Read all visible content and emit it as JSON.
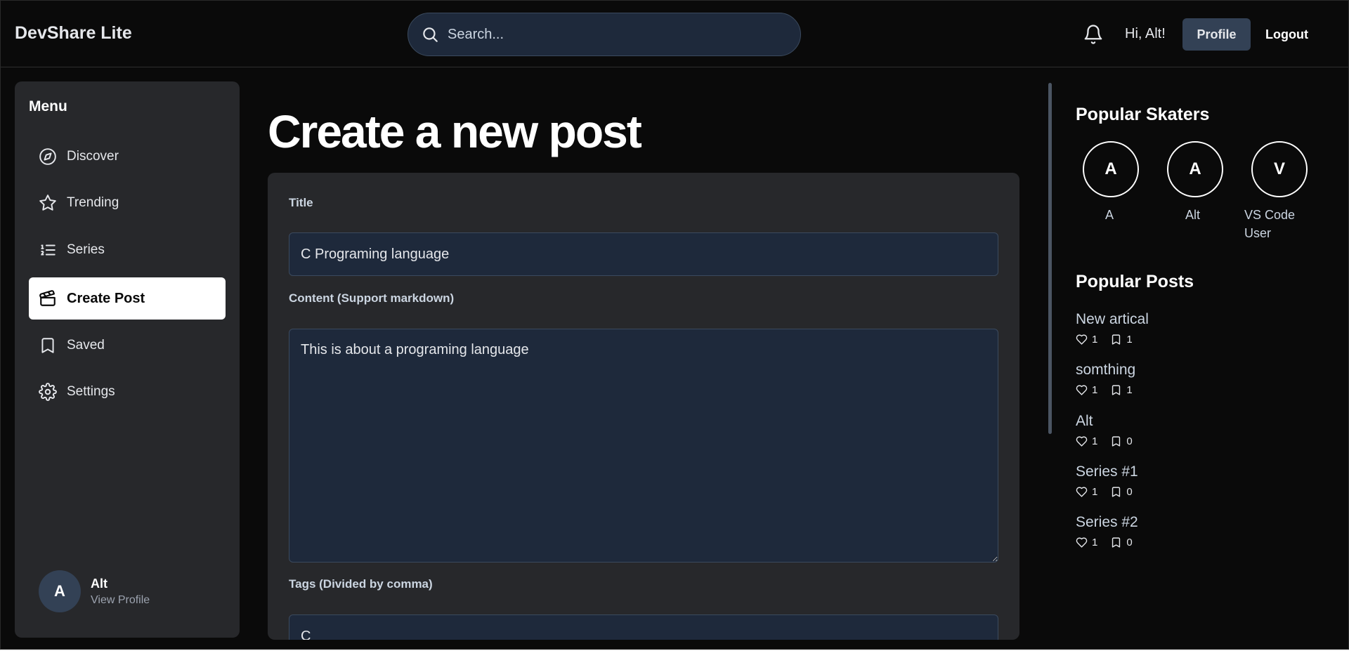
{
  "header": {
    "brand": "DevShare Lite",
    "search_placeholder": "Search...",
    "greeting": "Hi, Alt!",
    "profile_label": "Profile",
    "logout_label": "Logout"
  },
  "sidebar": {
    "title": "Menu",
    "items": [
      {
        "label": "Discover",
        "icon": "compass-icon"
      },
      {
        "label": "Trending",
        "icon": "star-icon"
      },
      {
        "label": "Series",
        "icon": "list-icon"
      },
      {
        "label": "Create Post",
        "icon": "clapperboard-icon",
        "active": true
      },
      {
        "label": "Saved",
        "icon": "bookmark-icon"
      },
      {
        "label": "Settings",
        "icon": "gear-icon"
      }
    ],
    "user": {
      "initial": "A",
      "name": "Alt",
      "sub": "View Profile"
    }
  },
  "main": {
    "title": "Create a new post",
    "form": {
      "title_label": "Title",
      "title_value": "C Programing language",
      "content_label": "Content (Support markdown)",
      "content_value": "This is about a programing language",
      "tags_label": "Tags (Divided by comma)",
      "tags_value": "C"
    }
  },
  "right_panel": {
    "skaters_title": "Popular Skaters",
    "skaters": [
      {
        "initial": "A",
        "name": "A"
      },
      {
        "initial": "A",
        "name": "Alt"
      },
      {
        "initial": "V",
        "name": "VS Code User"
      }
    ],
    "posts_title": "Popular Posts",
    "posts": [
      {
        "title": "New artical",
        "likes": "1",
        "saves": "1"
      },
      {
        "title": "somthing",
        "likes": "1",
        "saves": "1"
      },
      {
        "title": "Alt",
        "likes": "1",
        "saves": "0"
      },
      {
        "title": "Series #1",
        "likes": "1",
        "saves": "0"
      },
      {
        "title": "Series #2",
        "likes": "1",
        "saves": "0"
      }
    ]
  },
  "colors": {
    "background": "#0a0a0a",
    "panel": "#27282b",
    "input": "#1e293b",
    "accent_button": "#334155"
  }
}
